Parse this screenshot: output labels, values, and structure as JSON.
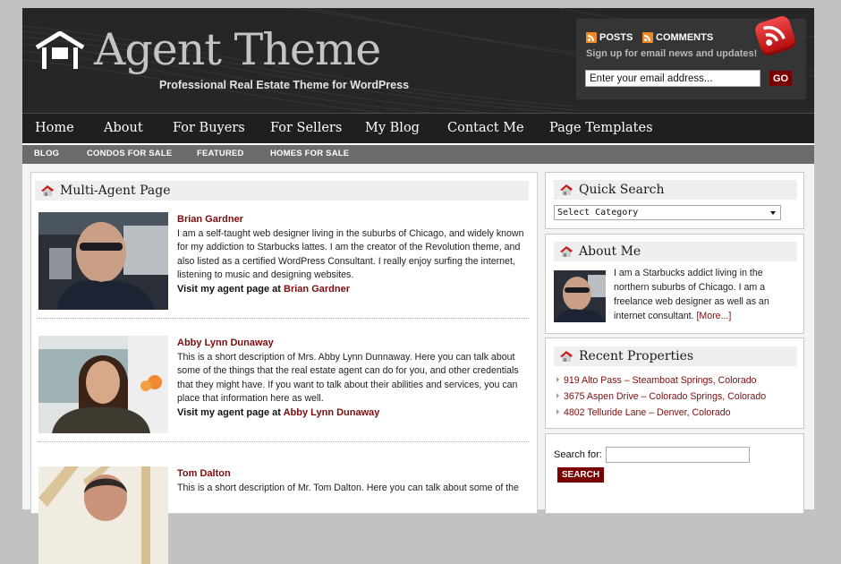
{
  "header": {
    "site_title": "Agent Theme",
    "tagline": "Professional Real Estate Theme for WordPress",
    "feeds": {
      "posts_label": "POSTS",
      "comments_label": "COMMENTS"
    },
    "signup_text": "Sign up for email news and updates!",
    "email_placeholder": "Enter your email address...",
    "email_value": "Enter your email address...",
    "go_label": "GO"
  },
  "primary_nav": [
    {
      "label": "Home"
    },
    {
      "label": "About"
    },
    {
      "label": "For Buyers"
    },
    {
      "label": "For Sellers"
    },
    {
      "label": "My Blog"
    },
    {
      "label": "Contact Me"
    },
    {
      "label": "Page Templates"
    }
  ],
  "secondary_nav": [
    {
      "label": "BLOG"
    },
    {
      "label": "CONDOS FOR SALE"
    },
    {
      "label": "FEATURED"
    },
    {
      "label": "HOMES FOR SALE"
    }
  ],
  "main": {
    "page_title": "Multi-Agent Page",
    "visit_prefix": "Visit my agent page at",
    "agents": [
      {
        "name": "Brian Gardner",
        "bio": "I am a self-taught web designer living in the suburbs of Chicago, and widely known for my addiction to Starbucks lattes. I am the creator of the Revolution theme, and also listed as a certified WordPress Consultant. I really enjoy surfing the internet, listening to music and designing websites.",
        "link_text": "Brian Gardner"
      },
      {
        "name": "Abby Lynn Dunaway",
        "bio": "This is a short description of Mrs. Abby Lynn Dunnaway. Here you can talk about some of the things that the real estate agent can do for you, and other credentials that they might have. If you want to talk about their abilities and services, you can place that information here as well.",
        "link_text": "Abby Lynn Dunaway"
      },
      {
        "name": "Tom Dalton",
        "bio": "This is a short description of Mr. Tom Dalton. Here you can talk about some of the",
        "link_text": "Tom Dalton"
      }
    ]
  },
  "sidebar": {
    "quick_search": {
      "title": "Quick Search",
      "select_value": "Select Category"
    },
    "about_me": {
      "title": "About Me",
      "text": "I am a Starbucks addict living in the northern suburbs of Chicago. I am a freelance web designer as well as an internet consultant.",
      "more_link": "[More...]"
    },
    "recent_properties": {
      "title": "Recent Properties",
      "items": [
        "919 Alto Pass – Steamboat Springs, Colorado",
        "3675 Aspen Drive – Colorado Springs, Colorado",
        "4802 Telluride Lane – Denver, Colorado"
      ]
    },
    "search": {
      "label": "Search for:",
      "value": "",
      "button_label": "SEARCH"
    }
  },
  "colors": {
    "accent": "#7a0000",
    "link": "#7a0d0d",
    "header_bg": "#262626",
    "nav_bg": "#1f1f1f",
    "subnav_bg": "#6b6b6b",
    "page_bg": "#c2c2c2"
  }
}
